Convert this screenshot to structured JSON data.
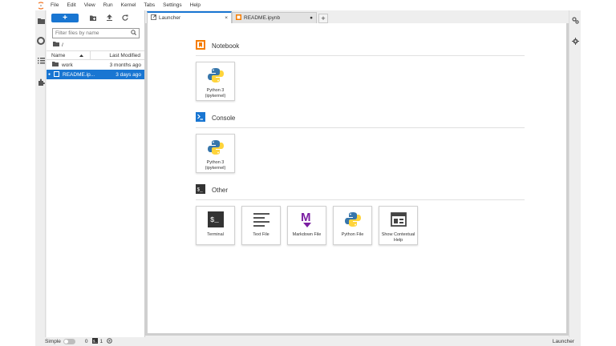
{
  "menu": [
    "File",
    "Edit",
    "View",
    "Run",
    "Kernel",
    "Tabs",
    "Settings",
    "Help"
  ],
  "filebrowser": {
    "new_label": "+",
    "search_placeholder": "Filter files by name",
    "breadcrumb": "/",
    "col_name": "Name",
    "col_modified": "Last Modified",
    "files": [
      {
        "name": "work",
        "modified": "3 months ago",
        "icon": "folder-icon"
      },
      {
        "name": "README.ip...",
        "modified": "3 days ago",
        "icon": "notebook-icon"
      }
    ]
  },
  "tabs": [
    {
      "label": "Launcher",
      "icon": "launcher-icon",
      "close": "×"
    },
    {
      "label": "README.ipynb",
      "icon": "notebook-icon",
      "close": "●"
    }
  ],
  "tab_add": "+",
  "launcher": {
    "notebook": {
      "title": "Notebook",
      "cards": [
        {
          "label": "Python 3 (ipykernel)"
        }
      ]
    },
    "console": {
      "title": "Console",
      "cards": [
        {
          "label": "Python 3 (ipykernel)"
        }
      ]
    },
    "other": {
      "title": "Other",
      "cards": [
        {
          "label": "Terminal"
        },
        {
          "label": "Text File"
        },
        {
          "label": "Markdown File"
        },
        {
          "label": "Python File"
        },
        {
          "label": "Show Contextual Help"
        }
      ]
    }
  },
  "statusbar": {
    "mode": "Simple",
    "terminals": "0",
    "kernels": "1",
    "right": "Launcher"
  },
  "colors": {
    "accent": "#1976d2",
    "orange": "#f57c00",
    "python_blue": "#3776ab",
    "python_yellow": "#ffd43b",
    "markdown": "#7b1fa2"
  }
}
